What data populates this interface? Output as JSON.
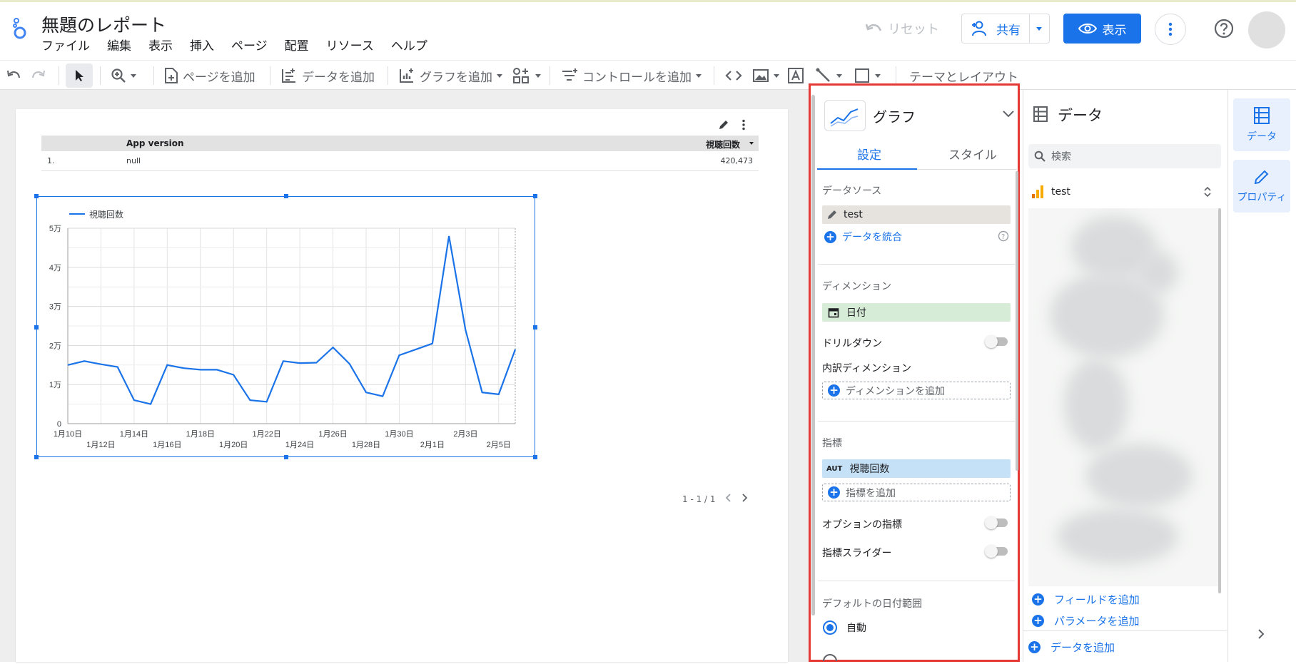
{
  "app": {
    "title": "無題のレポート",
    "menu": [
      "ファイル",
      "編集",
      "表示",
      "挿入",
      "ページ",
      "配置",
      "リソース",
      "ヘルプ"
    ],
    "reset_label": "リセット",
    "share_label": "共有",
    "view_label": "表示"
  },
  "toolbar": {
    "add_page": "ページを追加",
    "add_data": "データを追加",
    "add_chart": "グラフを追加",
    "add_control": "コントロールを追加",
    "theme_layout": "テーマとレイアウト"
  },
  "table": {
    "columns": [
      "App version",
      "視聴回数"
    ],
    "rows": [
      {
        "index": "1.",
        "version": "null",
        "views": "420,473"
      }
    ]
  },
  "chart": {
    "legend": "視聴回数",
    "pager": "1 - 1 / 1"
  },
  "chart_data": {
    "type": "line",
    "title": "",
    "xlabel": "",
    "ylabel": "",
    "x": [
      "1月10日",
      "1月11日",
      "1月12日",
      "1月13日",
      "1月14日",
      "1月15日",
      "1月16日",
      "1月17日",
      "1月18日",
      "1月19日",
      "1月20日",
      "1月21日",
      "1月22日",
      "1月23日",
      "1月24日",
      "1月25日",
      "1月26日",
      "1月27日",
      "1月28日",
      "1月29日",
      "1月30日",
      "1月31日",
      "2月1日",
      "2月2日",
      "2月3日",
      "2月4日",
      "2月5日",
      "2月6日"
    ],
    "x_tick_labels_top": [
      "1月10日",
      "1月14日",
      "1月18日",
      "1月22日",
      "1月26日",
      "1月30日",
      "2月3日"
    ],
    "x_tick_labels_bottom": [
      "1月12日",
      "1月16日",
      "1月20日",
      "1月24日",
      "1月28日",
      "2月1日",
      "2月5日"
    ],
    "series": [
      {
        "name": "視聴回数",
        "color": "#1a73e8",
        "values": [
          15000,
          16000,
          15200,
          14500,
          6000,
          5000,
          15000,
          14200,
          13800,
          13800,
          12500,
          6000,
          5600,
          16000,
          15500,
          15600,
          19500,
          15300,
          8000,
          7000,
          17500,
          19000,
          20500,
          48000,
          24000,
          8000,
          7500,
          19000
        ]
      }
    ],
    "y_ticks": [
      "0",
      "1万",
      "2万",
      "3万",
      "4万",
      "5万"
    ],
    "ylim": [
      0,
      50000
    ],
    "grid": true,
    "legend_position": "top-left"
  },
  "setup": {
    "chart_type": "グラフ",
    "tab_setup": "設定",
    "tab_style": "スタイル",
    "data_source_label": "データソース",
    "data_source": "test",
    "blend_label": "データを統合",
    "dimension_label": "ディメンション",
    "dimension": "日付",
    "drilldown_label": "ドリルダウン",
    "breakdown_label": "内訳ディメンション",
    "add_dimension": "ディメンションを追加",
    "metric_label": "指標",
    "metric_badge": "AUT",
    "metric": "視聴回数",
    "add_metric": "指標を追加",
    "optional_metric_label": "オプションの指標",
    "metric_slider_label": "指標スライダー",
    "date_range_label": "デフォルトの日付範囲",
    "auto_label": "自動"
  },
  "data_panel": {
    "title": "データ",
    "search_placeholder": "検索",
    "source": "test",
    "add_field": "フィールドを追加",
    "add_parameter": "パラメータを追加",
    "add_data": "データを追加"
  },
  "rail": {
    "data": "データ",
    "properties": "プロパティ"
  }
}
